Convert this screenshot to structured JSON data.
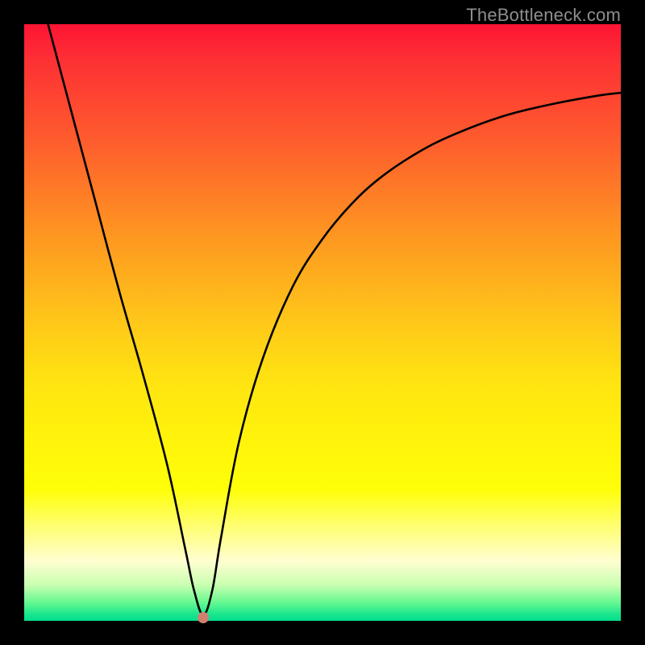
{
  "watermark": "TheBottleneck.com",
  "chart_data": {
    "type": "line",
    "title": "",
    "xlabel": "",
    "ylabel": "",
    "xlim": [
      0,
      100
    ],
    "ylim": [
      0,
      100
    ],
    "series": [
      {
        "name": "curve",
        "x": [
          4,
          8,
          12,
          16,
          20,
          24,
          27,
          28.5,
          30,
          31.5,
          33,
          36,
          40,
          45,
          50,
          55,
          60,
          66,
          72,
          80,
          88,
          96,
          100
        ],
        "y": [
          100,
          85,
          70,
          55,
          41,
          26,
          12,
          5,
          1,
          5,
          14,
          30,
          44,
          56,
          64,
          70,
          74.5,
          78.5,
          81.5,
          84.5,
          86.5,
          88,
          88.5
        ]
      }
    ],
    "marker": {
      "x": 30,
      "y": 0.5,
      "color": "#d08070"
    },
    "gradient_stops": [
      {
        "pos": 0,
        "color": "#fd1434"
      },
      {
        "pos": 50,
        "color": "#ffc819"
      },
      {
        "pos": 80,
        "color": "#fffe09"
      },
      {
        "pos": 100,
        "color": "#04df8d"
      }
    ]
  }
}
